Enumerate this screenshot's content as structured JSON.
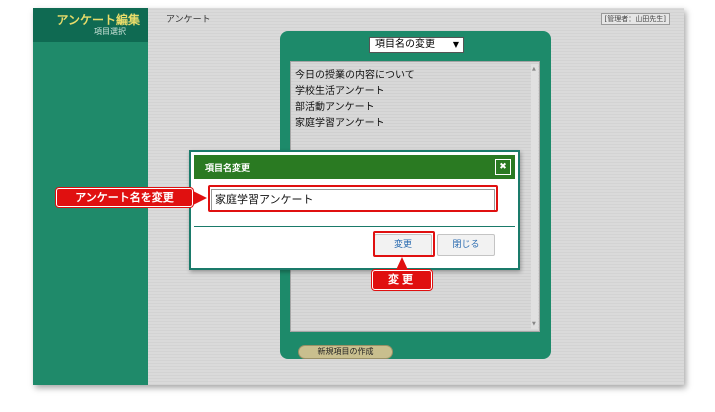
{
  "sidebar": {
    "app_title": "アンケート編集",
    "app_subtitle": "項目選択"
  },
  "header": {
    "breadcrumb": "アンケート",
    "admin_badge": "[管理者：山田先生]"
  },
  "panel": {
    "select_value": "項目名の変更",
    "items": [
      "今日の授業の内容について",
      "学校生活アンケート",
      "部活動アンケート",
      "家庭学習アンケート"
    ],
    "new_item_button": "新規項目の作成"
  },
  "modal": {
    "title": "項目名変更",
    "close_glyph": "✖",
    "input_value": "家庭学習アンケート",
    "change_button": "変更",
    "close_button": "閉じる"
  },
  "annotations": {
    "input_callout": "アンケート名を変更",
    "button_callout": "変更",
    "highlight_color": "#e01010"
  },
  "colors": {
    "sidebar": "#1f8a6a",
    "panel": "#1d8a6a",
    "modal_header": "#2a7a22"
  }
}
